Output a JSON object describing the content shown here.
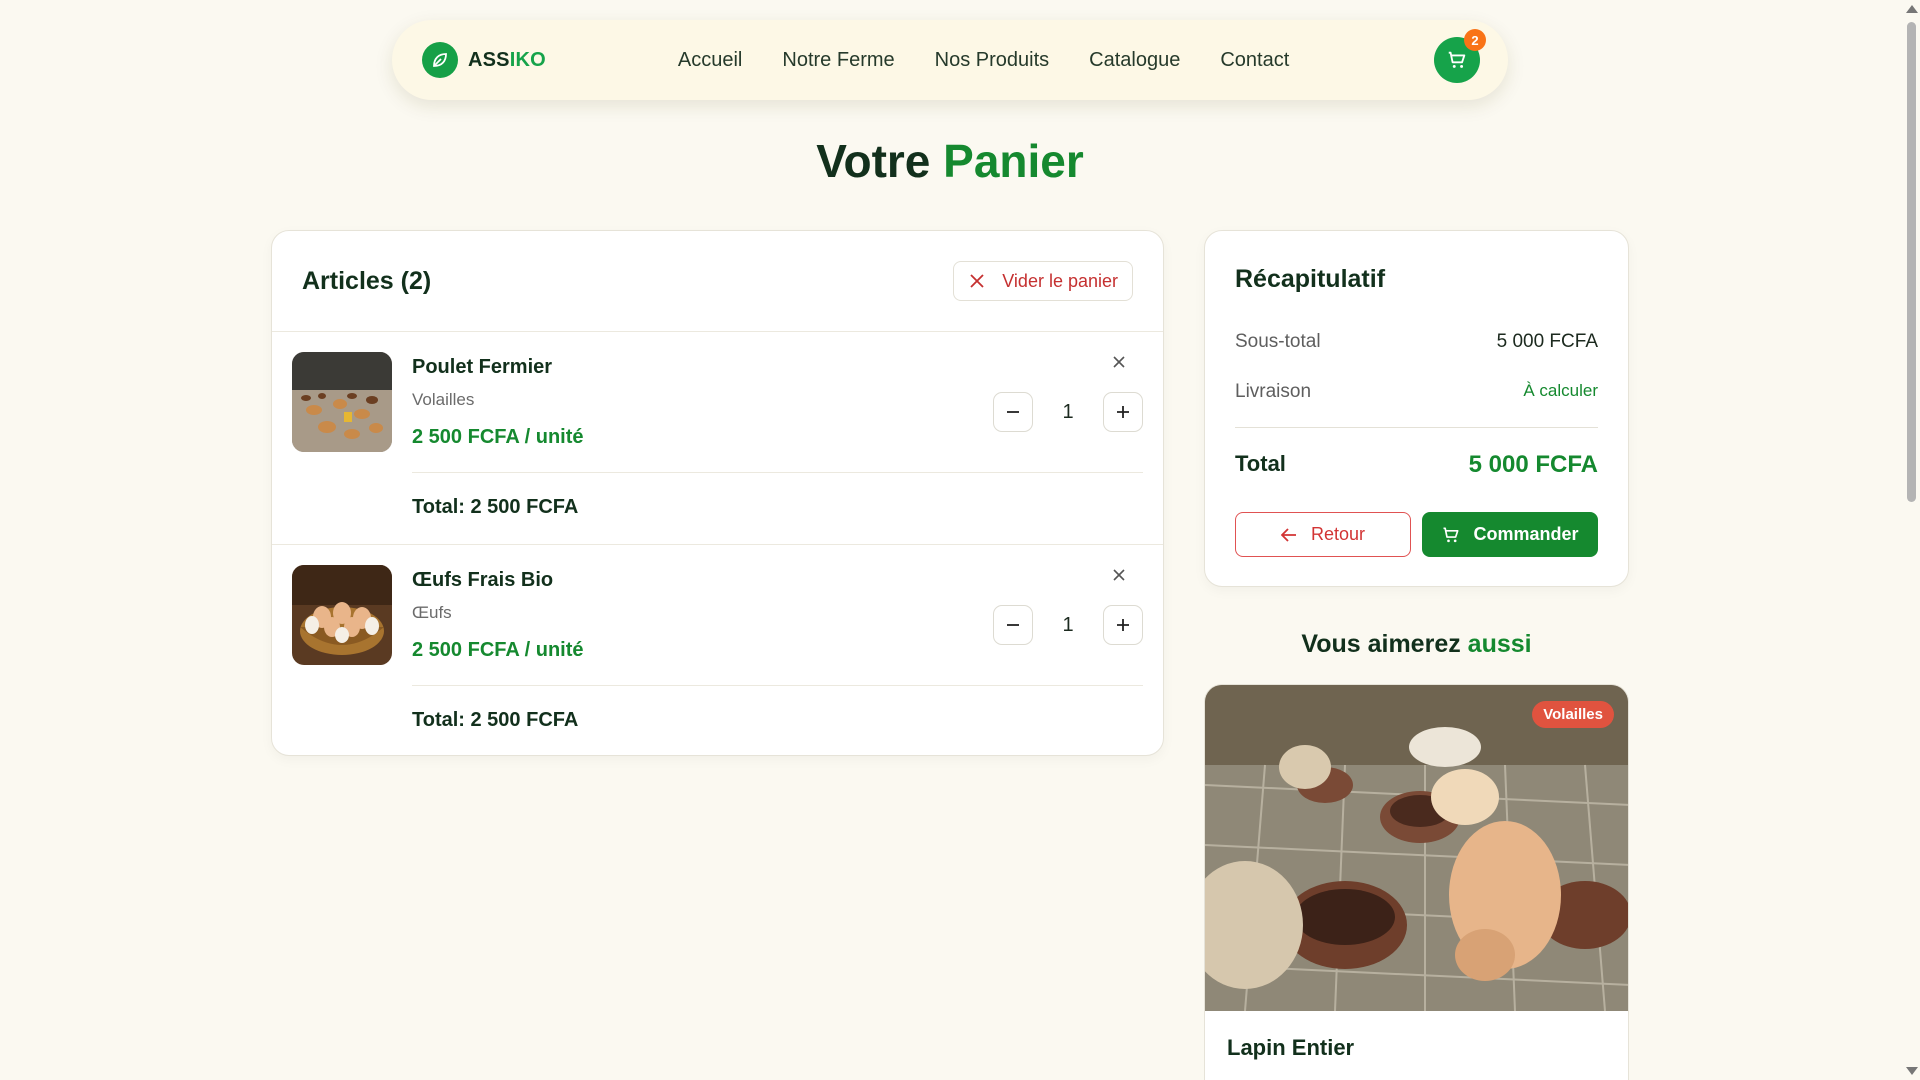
{
  "brand": {
    "name_part1": "ASS",
    "name_part2": "IKO",
    "icon": "leaf-icon",
    "color": "#16a34a"
  },
  "nav": {
    "links": [
      "Accueil",
      "Notre Ferme",
      "Nos Produits",
      "Catalogue",
      "Contact"
    ],
    "cart_count": "2"
  },
  "page_title": {
    "part1": "Votre ",
    "part2": "Panier"
  },
  "cart": {
    "heading": "Articles (2)",
    "clear_label": "Vider le panier",
    "items": [
      {
        "name": "Poulet Fermier",
        "category": "Volailles",
        "unit_price": "2 500 FCFA / unité",
        "quantity": "1",
        "total": "Total: 2 500 FCFA",
        "image": "chickens-photo"
      },
      {
        "name": "Œufs Frais Bio",
        "category": "Œufs",
        "unit_price": "2 500 FCFA / unité",
        "quantity": "1",
        "total": "Total: 2 500 FCFA",
        "image": "eggs-basket-photo"
      }
    ]
  },
  "summary": {
    "title": "Récapitulatif",
    "subtotal_label": "Sous-total",
    "subtotal_value": "5 000 FCFA",
    "shipping_label": "Livraison",
    "shipping_value": "À calculer",
    "total_label": "Total",
    "total_value": "5 000 FCFA",
    "back_label": "Retour",
    "order_label": "Commander"
  },
  "suggestions": {
    "title_part1": "Vous aimerez ",
    "title_part2": "aussi",
    "product": {
      "name": "Lapin Entier",
      "badge": "Volailles",
      "image": "rabbits-photo"
    }
  },
  "colors": {
    "accent": "#15892f",
    "danger": "#d23434",
    "badge_orange": "#f97316",
    "page_bg": "#fbf9f1"
  }
}
